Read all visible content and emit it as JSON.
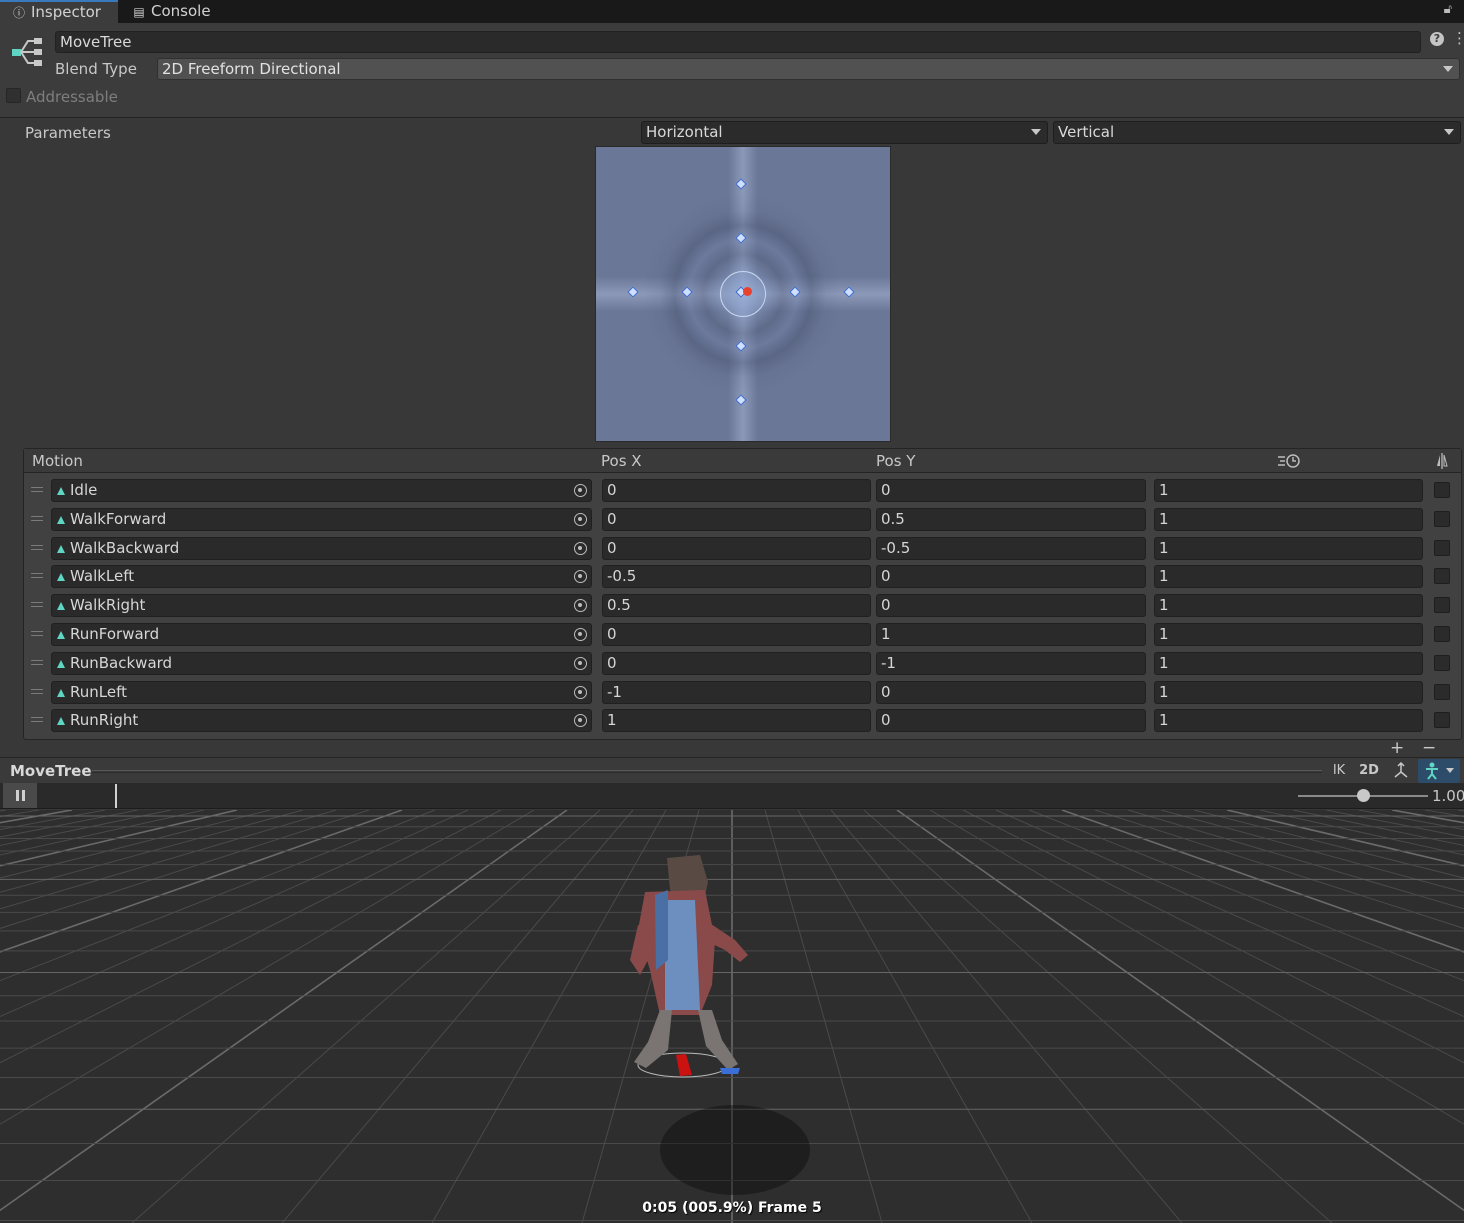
{
  "tabs": [
    {
      "label": "Inspector",
      "icon": "info-icon"
    },
    {
      "label": "Console",
      "icon": "console-icon"
    }
  ],
  "header": {
    "name": "MoveTree",
    "blend_type_label": "Blend Type",
    "blend_type_value": "2D Freeform Directional",
    "addressable_label": "Addressable"
  },
  "parameters": {
    "label": "Parameters",
    "x_param": "Horizontal",
    "y_param": "Vertical"
  },
  "table": {
    "headers": {
      "motion": "Motion",
      "pos_x": "Pos X",
      "pos_y": "Pos Y"
    },
    "rows": [
      {
        "motion": "Idle",
        "x": "0",
        "y": "0",
        "speed": "1"
      },
      {
        "motion": "WalkForward",
        "x": "0",
        "y": "0.5",
        "speed": "1"
      },
      {
        "motion": "WalkBackward",
        "x": "0",
        "y": "-0.5",
        "speed": "1"
      },
      {
        "motion": "WalkLeft",
        "x": "-0.5",
        "y": "0",
        "speed": "1"
      },
      {
        "motion": "WalkRight",
        "x": "0.5",
        "y": "0",
        "speed": "1"
      },
      {
        "motion": "RunForward",
        "x": "0",
        "y": "1",
        "speed": "1"
      },
      {
        "motion": "RunBackward",
        "x": "0",
        "y": "-1",
        "speed": "1"
      },
      {
        "motion": "RunLeft",
        "x": "-1",
        "y": "0",
        "speed": "1"
      },
      {
        "motion": "RunRight",
        "x": "1",
        "y": "0",
        "speed": "1"
      }
    ],
    "add_label": "+",
    "remove_label": "−"
  },
  "preview": {
    "title": "MoveTree",
    "ik_label": "IK",
    "twod_label": "2D",
    "speed_value": "1.00",
    "speed_fraction": 0.5,
    "frame_text": "0:05 (005.9%) Frame 5"
  },
  "colors": {
    "accent": "#3a79bb",
    "anim_icon": "#5fd6c4",
    "blend_point": "#cfe0ff",
    "current_point": "#e8412e"
  }
}
